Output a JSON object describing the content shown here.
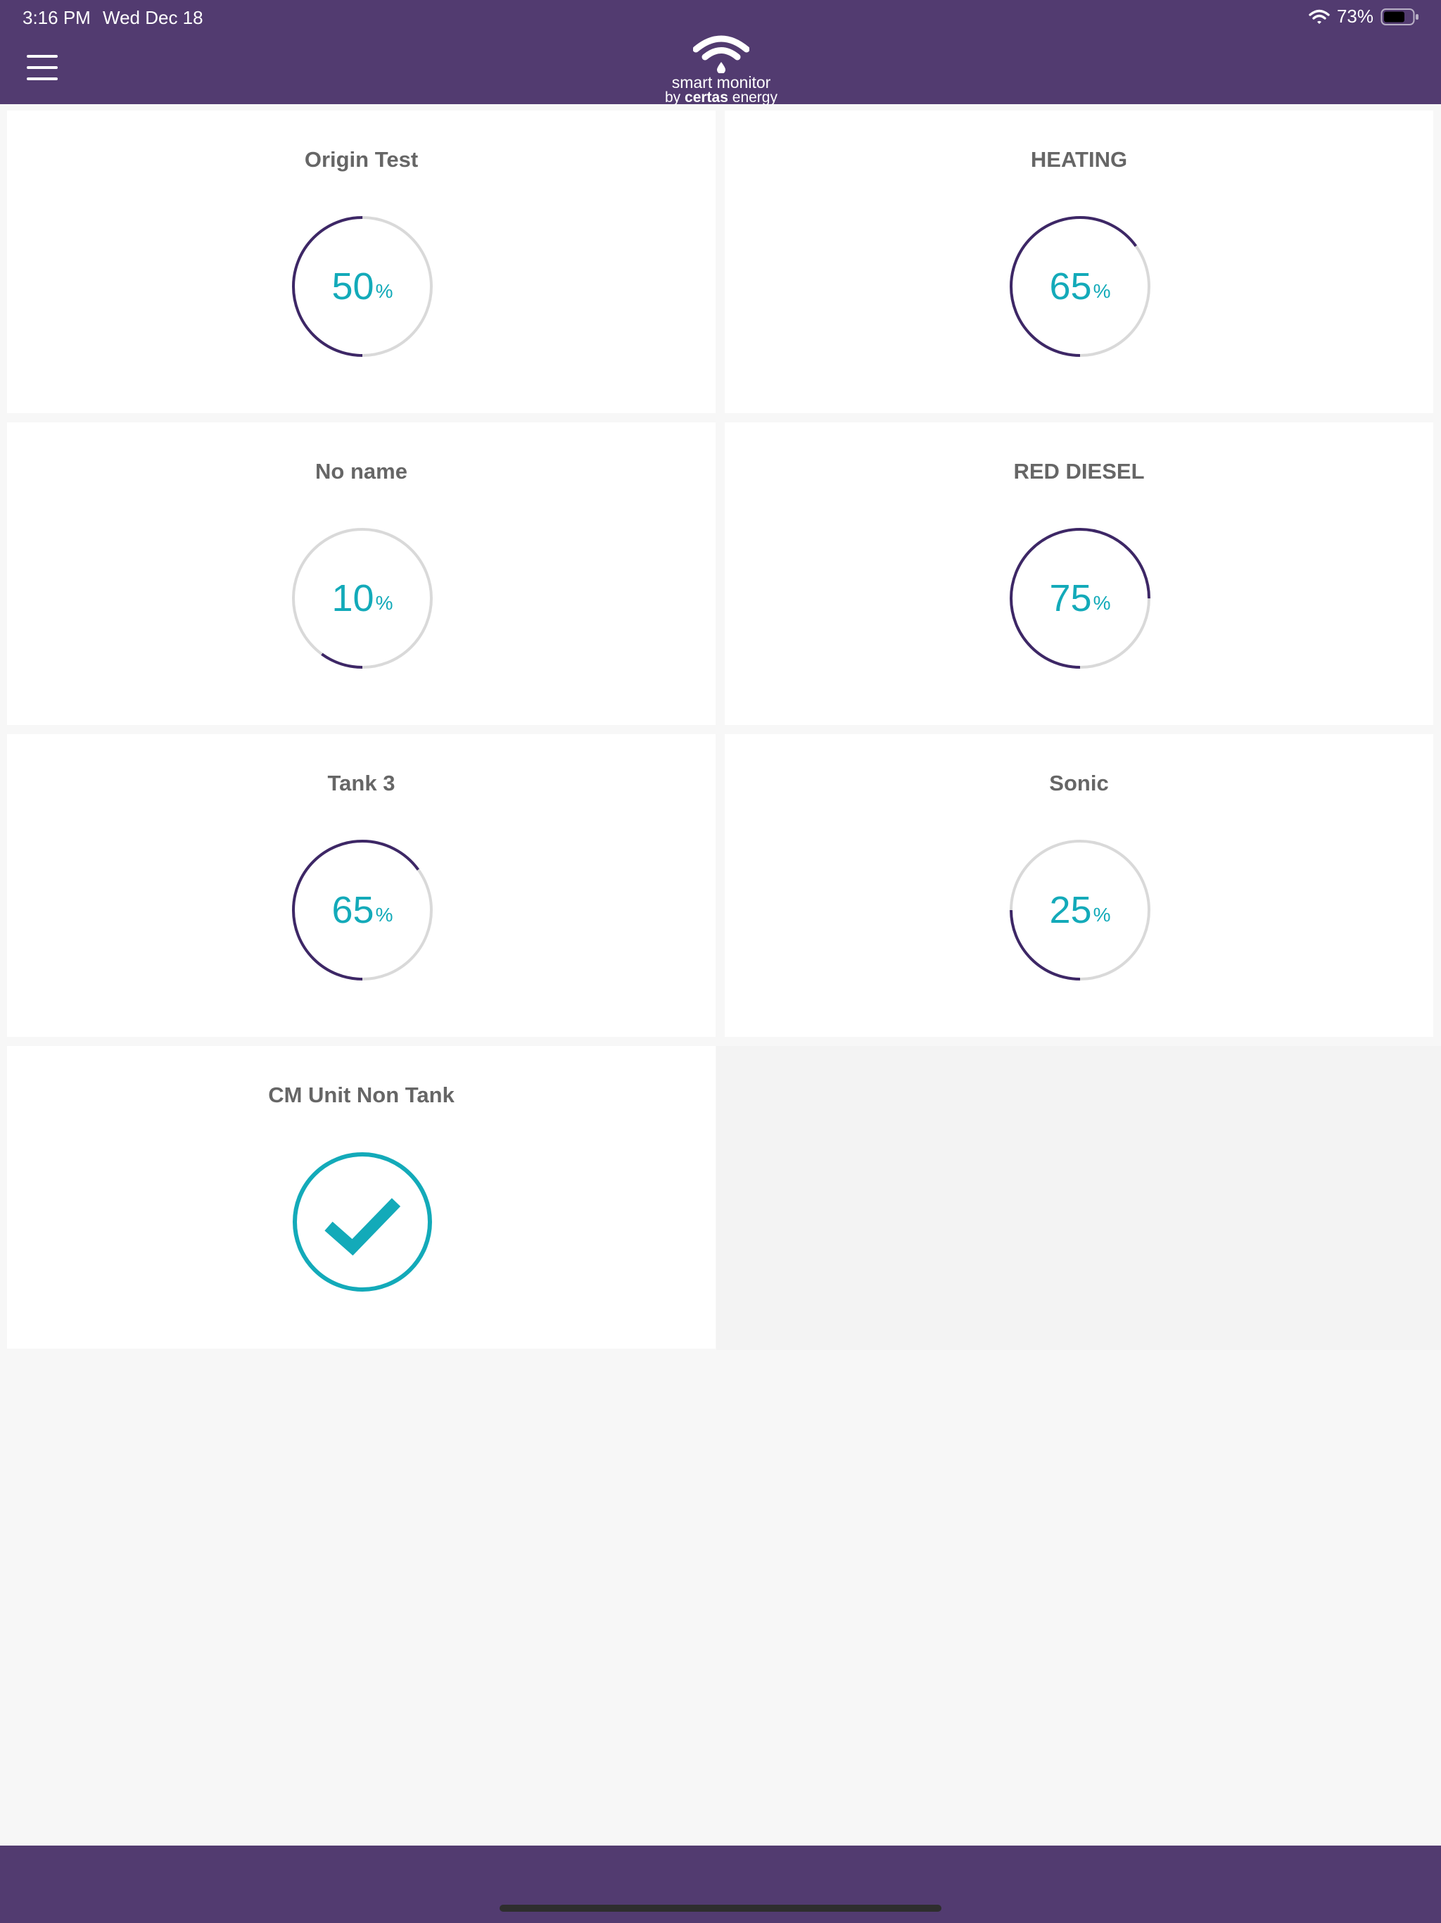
{
  "status_bar": {
    "time": "3:16 PM",
    "date": "Wed Dec 18",
    "battery": "73%"
  },
  "header": {
    "logo_line1": "smart monitor",
    "logo_by": "by",
    "logo_brand": "certas",
    "logo_suffix": "energy"
  },
  "colors": {
    "header_bg": "#523b70",
    "arc": "#3d2766",
    "track": "#d9d9d9",
    "value_text": "#13aab9"
  },
  "tanks": [
    {
      "name": "Origin Test",
      "value": "50",
      "unit": "%",
      "fill": 0.5
    },
    {
      "name": "HEATING",
      "value": "65",
      "unit": "%",
      "fill": 0.65
    },
    {
      "name": "No name",
      "value": "10",
      "unit": "%",
      "fill": 0.1
    },
    {
      "name": "RED DIESEL",
      "value": "75",
      "unit": "%",
      "fill": 0.75
    },
    {
      "name": "Tank 3",
      "value": "65",
      "unit": "%",
      "fill": 0.65
    },
    {
      "name": "Sonic",
      "value": "25",
      "unit": "%",
      "fill": 0.25
    }
  ],
  "unit_card": {
    "name": "CM Unit Non Tank",
    "status_icon": "checkmark-circle-icon"
  }
}
